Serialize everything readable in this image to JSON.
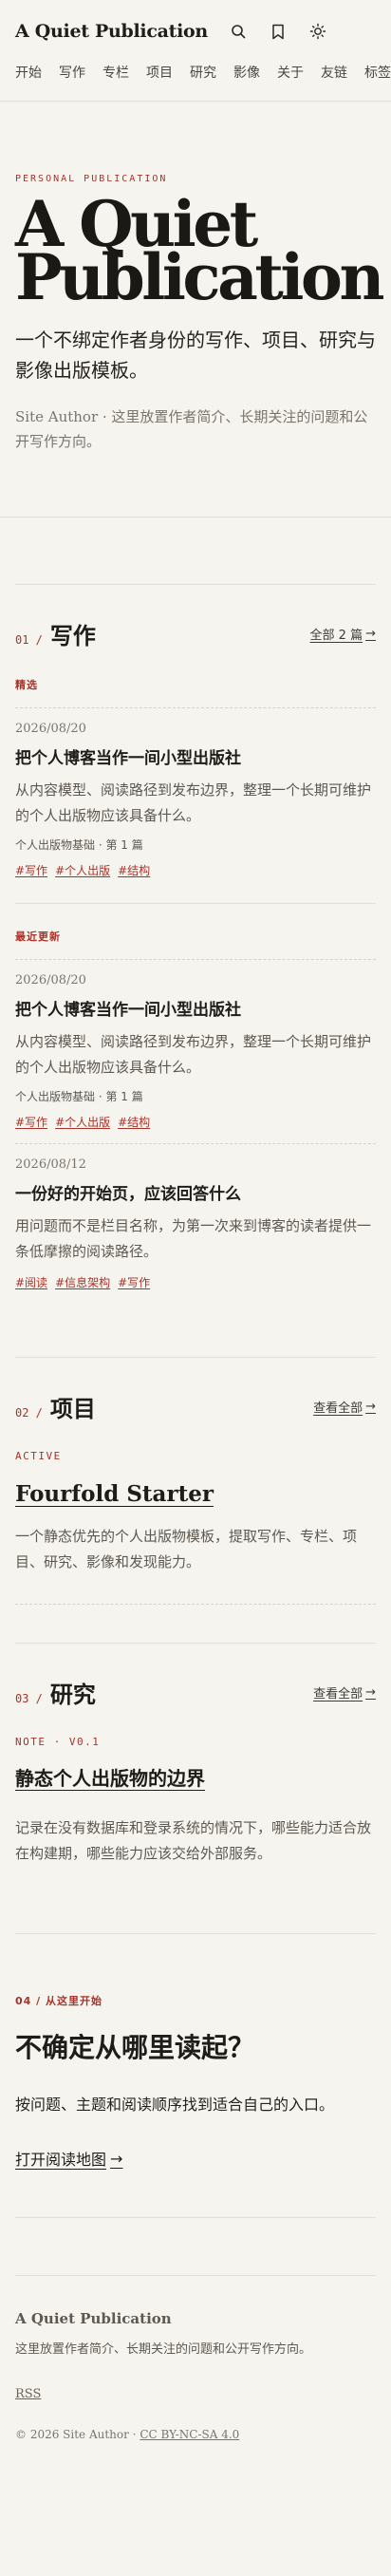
{
  "site": {
    "brand": "A Quiet Publication"
  },
  "header": {
    "icons": [
      "search-icon",
      "bookmark-icon",
      "sun-icon"
    ],
    "nav": [
      "开始",
      "写作",
      "专栏",
      "项目",
      "研究",
      "影像",
      "关于",
      "友链",
      "标签"
    ]
  },
  "hero": {
    "kicker": "PERSONAL PUBLICATION",
    "title_line1": "A Quiet",
    "title_line2": "Publication",
    "subtitle": "一个不绑定作者身份的写作、项目、研究与影像出版模板。",
    "desc": "Site Author · 这里放置作者简介、长期关注的问题和公开写作方向。"
  },
  "writing": {
    "num": "01 /",
    "title": "写作",
    "all_link": "全部 2 篇",
    "featured_label": "精选",
    "featured": {
      "date": "2026/08/20",
      "title": "把个人博客当作一间小型出版社",
      "excerpt": "从内容模型、阅读路径到发布边界，整理一个长期可维护的个人出版物应该具备什么。",
      "meta": "个人出版物基础 · 第 1 篇",
      "tags": [
        "#写作",
        "#个人出版",
        "#结构"
      ]
    },
    "recent_label": "最近更新",
    "recent": [
      {
        "date": "2026/08/20",
        "title": "把个人博客当作一间小型出版社",
        "excerpt": "从内容模型、阅读路径到发布边界，整理一个长期可维护的个人出版物应该具备什么。",
        "meta": "个人出版物基础 · 第 1 篇",
        "tags": [
          "#写作",
          "#个人出版",
          "#结构"
        ]
      },
      {
        "date": "2026/08/12",
        "title": "一份好的开始页，应该回答什么",
        "excerpt": "用问题而不是栏目名称，为第一次来到博客的读者提供一条低摩擦的阅读路径。",
        "tags": [
          "#阅读",
          "#信息架构",
          "#写作"
        ]
      }
    ]
  },
  "projects": {
    "num": "02 /",
    "title": "项目",
    "all_link": "查看全部",
    "status": "ACTIVE",
    "item_title": "Fourfold Starter",
    "item_desc": "一个静态优先的个人出版物模板，提取写作、专栏、项目、研究、影像和发现能力。"
  },
  "research": {
    "num": "03 /",
    "title": "研究",
    "all_link": "查看全部",
    "label": "NOTE · V0.1",
    "item_title": "静态个人出版物的边界",
    "item_desc": "记录在没有数据库和登录系统的情况下，哪些能力适合放在构建期，哪些能力应该交给外部服务。"
  },
  "start": {
    "label": "04 / 从这里开始",
    "title": "不确定从哪里读起？",
    "desc": "按问题、主题和阅读顺序找到适合自己的入口。",
    "link": "打开阅读地图"
  },
  "footer": {
    "brand": "A Quiet Publication",
    "desc": "这里放置作者简介、长期关注的问题和公开写作方向。",
    "rss": "RSS",
    "copy": "© 2026 Site Author · ",
    "license": "CC BY-NC-SA 4.0"
  }
}
